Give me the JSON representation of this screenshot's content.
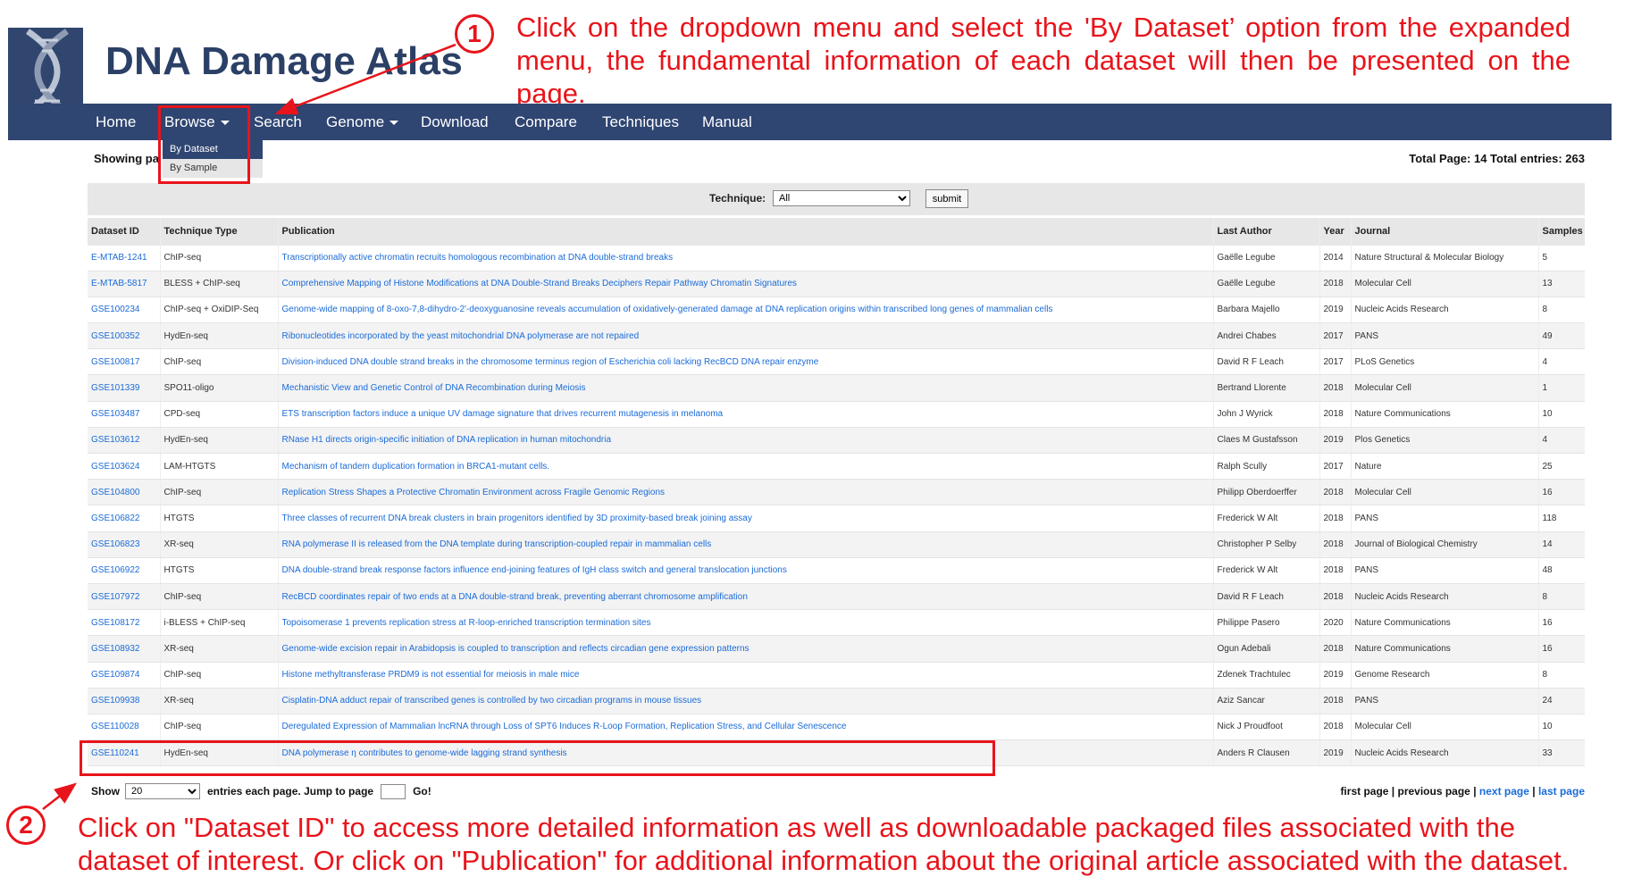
{
  "brand": {
    "title": "DNA Damage Atlas"
  },
  "annotations": {
    "step1": {
      "number": "1",
      "text": "Click on the dropdown menu and select the 'By Dataset’ option from the expanded menu, the fundamental information of each dataset will then be presented on the page."
    },
    "step2": {
      "number": "2",
      "text": "Click on \"Dataset ID\" to access more detailed information as well as downloadable packaged files associated with the dataset of interest. Or click on \"Publication\" for additional information about the original article associated with the dataset."
    },
    "color": "#e8141b"
  },
  "nav": {
    "home": "Home",
    "browse": "Browse",
    "search": "Search",
    "genome": "Genome",
    "download": "Download",
    "compare": "Compare",
    "techniques": "Techniques",
    "manual": "Manual",
    "browse_menu": {
      "by_dataset": "By Dataset",
      "by_sample": "By Sample"
    },
    "color": "#2f4572"
  },
  "info": {
    "showing": "Showing pa",
    "totals": "Total Page: 14 Total entries: 263"
  },
  "filter": {
    "label": "Technique:",
    "selected": "All",
    "submit": "submit"
  },
  "table": {
    "headers": [
      "Dataset ID",
      "Technique Type",
      "Publication",
      "Last Author",
      "Year",
      "Journal",
      "Samples"
    ],
    "rows": [
      [
        "E-MTAB-1241",
        "ChIP-seq",
        "Transcriptionally active chromatin recruits homologous recombination at DNA double-strand breaks",
        "Gaëlle Legube",
        "2014",
        "Nature Structural & Molecular Biology",
        "5"
      ],
      [
        "E-MTAB-5817",
        "BLESS + ChIP-seq",
        "Comprehensive Mapping of Histone Modifications at DNA Double-Strand Breaks Deciphers Repair Pathway Chromatin Signatures",
        "Gaëlle Legube",
        "2018",
        "Molecular Cell",
        "13"
      ],
      [
        "GSE100234",
        "ChIP-seq + OxiDIP-Seq",
        "Genome-wide mapping of 8-oxo-7,8-dihydro-2'-deoxyguanosine reveals accumulation of oxidatively-generated damage at DNA replication origins within transcribed long genes of mammalian cells",
        "Barbara Majello",
        "2019",
        "Nucleic Acids Research",
        "8"
      ],
      [
        "GSE100352",
        "HydEn-seq",
        "Ribonucleotides incorporated by the yeast mitochondrial DNA polymerase are not repaired",
        "Andrei Chabes",
        "2017",
        "PANS",
        "49"
      ],
      [
        "GSE100817",
        "ChIP-seq",
        "Division-induced DNA double strand breaks in the chromosome terminus region of Escherichia coli lacking RecBCD DNA repair enzyme",
        "David R F Leach",
        "2017",
        "PLoS Genetics",
        "4"
      ],
      [
        "GSE101339",
        "SPO11-oligo",
        "Mechanistic View and Genetic Control of DNA Recombination during Meiosis",
        "Bertrand Llorente",
        "2018",
        "Molecular Cell",
        "1"
      ],
      [
        "GSE103487",
        "CPD-seq",
        "ETS transcription factors induce a unique UV damage signature that drives recurrent mutagenesis in melanoma",
        "John J Wyrick",
        "2018",
        "Nature Communications",
        "10"
      ],
      [
        "GSE103612",
        "HydEn-seq",
        "RNase H1 directs origin-specific initiation of DNA replication in human mitochondria",
        "Claes M Gustafsson",
        "2019",
        "Plos Genetics",
        "4"
      ],
      [
        "GSE103624",
        "LAM-HTGTS",
        "Mechanism of tandem duplication formation in BRCA1-mutant cells.",
        "Ralph Scully",
        "2017",
        "Nature",
        "25"
      ],
      [
        "GSE104800",
        "ChIP-seq",
        "Replication Stress Shapes a Protective Chromatin Environment across Fragile Genomic Regions",
        "Philipp Oberdoerffer",
        "2018",
        "Molecular Cell",
        "16"
      ],
      [
        "GSE106822",
        "HTGTS",
        "Three classes of recurrent DNA break clusters in brain progenitors identified by 3D proximity-based break joining assay",
        "Frederick W Alt",
        "2018",
        "PANS",
        "118"
      ],
      [
        "GSE106823",
        "XR-seq",
        "RNA polymerase II is released from the DNA template during transcription-coupled repair in mammalian cells",
        "Christopher P Selby",
        "2018",
        "Journal of Biological Chemistry",
        "14"
      ],
      [
        "GSE106922",
        "HTGTS",
        "DNA double-strand break response factors influence end-joining features of IgH class switch and general translocation junctions",
        "Frederick W Alt",
        "2018",
        "PANS",
        "48"
      ],
      [
        "GSE107972",
        "ChIP-seq",
        "RecBCD coordinates repair of two ends at a DNA double-strand break, preventing aberrant chromosome amplification",
        "David R F Leach",
        "2018",
        "Nucleic Acids Research",
        "8"
      ],
      [
        "GSE108172",
        "i-BLESS + ChIP-seq",
        "Topoisomerase 1 prevents replication stress at R-loop-enriched transcription termination sites",
        "Philippe Pasero",
        "2020",
        "Nature Communications",
        "16"
      ],
      [
        "GSE108932",
        "XR-seq",
        "Genome-wide excision repair in Arabidopsis is coupled to transcription and reflects circadian gene expression patterns",
        "Ogun Adebali",
        "2018",
        "Nature Communications",
        "16"
      ],
      [
        "GSE109874",
        "ChIP-seq",
        "Histone methyltransferase PRDM9 is not essential for meiosis in male mice",
        "Zdenek Trachtulec",
        "2019",
        "Genome Research",
        "8"
      ],
      [
        "GSE109938",
        "XR-seq",
        "Cisplatin-DNA adduct repair of transcribed genes is controlled by two circadian programs in mouse tissues",
        "Aziz Sancar",
        "2018",
        "PANS",
        "24"
      ],
      [
        "GSE110028",
        "ChIP-seq",
        "Deregulated Expression of Mammalian lncRNA through Loss of SPT6 Induces R-Loop Formation, Replication Stress, and Cellular Senescence",
        "Nick J Proudfoot",
        "2018",
        "Molecular Cell",
        "10"
      ],
      [
        "GSE110241",
        "HydEn-seq",
        "DNA polymerase η contributes to genome-wide lagging strand synthesis",
        "Anders R Clausen",
        "2019",
        "Nucleic Acids Research",
        "33"
      ]
    ]
  },
  "pagination": {
    "show": "Show",
    "per_page": "20",
    "entries_text": "entries each page.",
    "jump_text": "Jump to page",
    "go": "Go!",
    "first": "first page",
    "sep": "|",
    "previous": "previous page",
    "next": "next page",
    "last": "last page"
  }
}
